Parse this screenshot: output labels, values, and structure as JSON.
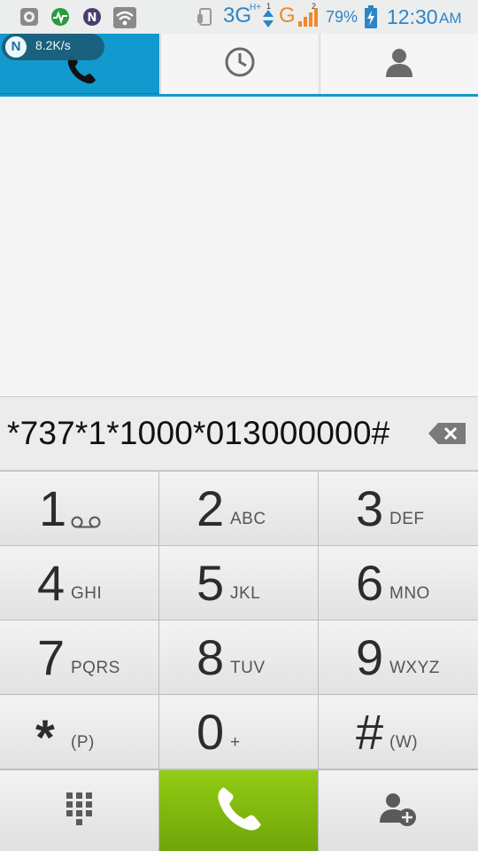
{
  "status_bar": {
    "network_speed": "8.2K/s",
    "network_logo": "N",
    "network_type_1": "3G",
    "network_type_1_badge": "H+",
    "sim1_index": "1",
    "network_type_2": "G",
    "sim2_index": "2",
    "battery": "79%",
    "time": "12:30",
    "ampm": "AM",
    "icons": [
      "screenshot-icon",
      "activity-icon",
      "notification-n-icon",
      "wifi-icon",
      "data-transfer-icon",
      "signal-icon",
      "battery-charging-icon"
    ],
    "colors": {
      "blue": "#2b86c9",
      "orange": "#f0892a"
    }
  },
  "tabs": [
    {
      "name": "phone",
      "icon": "phone-icon",
      "selected": true
    },
    {
      "name": "recent",
      "icon": "clock-icon",
      "selected": false
    },
    {
      "name": "contacts",
      "icon": "person-icon",
      "selected": false
    }
  ],
  "dialer": {
    "number": "*737*1*1000*013000000#",
    "backspace_icon": "backspace-icon"
  },
  "keypad": {
    "keys": [
      {
        "num": "1",
        "sub": "voicemail-icon"
      },
      {
        "num": "2",
        "sub": "ABC"
      },
      {
        "num": "3",
        "sub": "DEF"
      },
      {
        "num": "4",
        "sub": "GHI"
      },
      {
        "num": "5",
        "sub": "JKL"
      },
      {
        "num": "6",
        "sub": "MNO"
      },
      {
        "num": "7",
        "sub": "PQRS"
      },
      {
        "num": "8",
        "sub": "TUV"
      },
      {
        "num": "9",
        "sub": "WXYZ"
      },
      {
        "num": "*",
        "sub": "(P)"
      },
      {
        "num": "0",
        "sub": "+"
      },
      {
        "num": "#",
        "sub": "(W)"
      }
    ]
  },
  "bottom_bar": {
    "dialpad_icon": "dialpad-icon",
    "call_icon": "call-icon",
    "add_contact_icon": "add-contact-icon",
    "call_color": "#84bd0f"
  }
}
